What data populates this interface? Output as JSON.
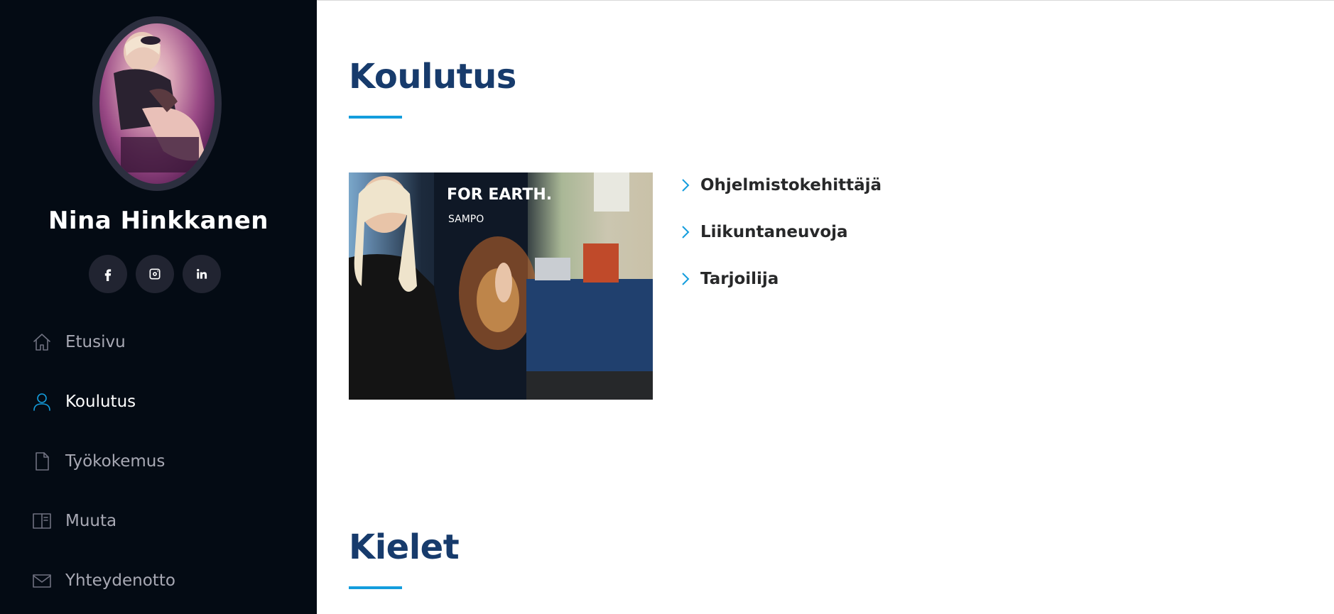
{
  "profile": {
    "name": "Nina Hinkkanen",
    "avatar_icon": "profile-photo"
  },
  "social": [
    {
      "name": "facebook",
      "icon": "facebook-icon"
    },
    {
      "name": "instagram",
      "icon": "instagram-icon"
    },
    {
      "name": "linkedin",
      "icon": "linkedin-icon"
    }
  ],
  "nav": {
    "items": [
      {
        "label": "Etusivu",
        "icon": "home-icon",
        "active": false
      },
      {
        "label": "Koulutus",
        "icon": "person-icon",
        "active": true
      },
      {
        "label": "Työkokemus",
        "icon": "document-icon",
        "active": false
      },
      {
        "label": "Muuta",
        "icon": "book-icon",
        "active": false
      },
      {
        "label": "Yhteydenotto",
        "icon": "envelope-icon",
        "active": false
      }
    ]
  },
  "sections": {
    "koulutus": {
      "title": "Koulutus",
      "items": [
        "Ohjelmistokehittäjä",
        "Liikuntaneuvoja",
        "Tarjoilija"
      ]
    },
    "kielet": {
      "title": "Kielet"
    }
  },
  "photo": {
    "banner_text": "FOR EARTH.",
    "brand": "SAMPO"
  },
  "colors": {
    "sidebar_bg": "#040b14",
    "accent": "#149ddd",
    "heading": "#173b6c",
    "nav_text": "#a8a9b4"
  }
}
